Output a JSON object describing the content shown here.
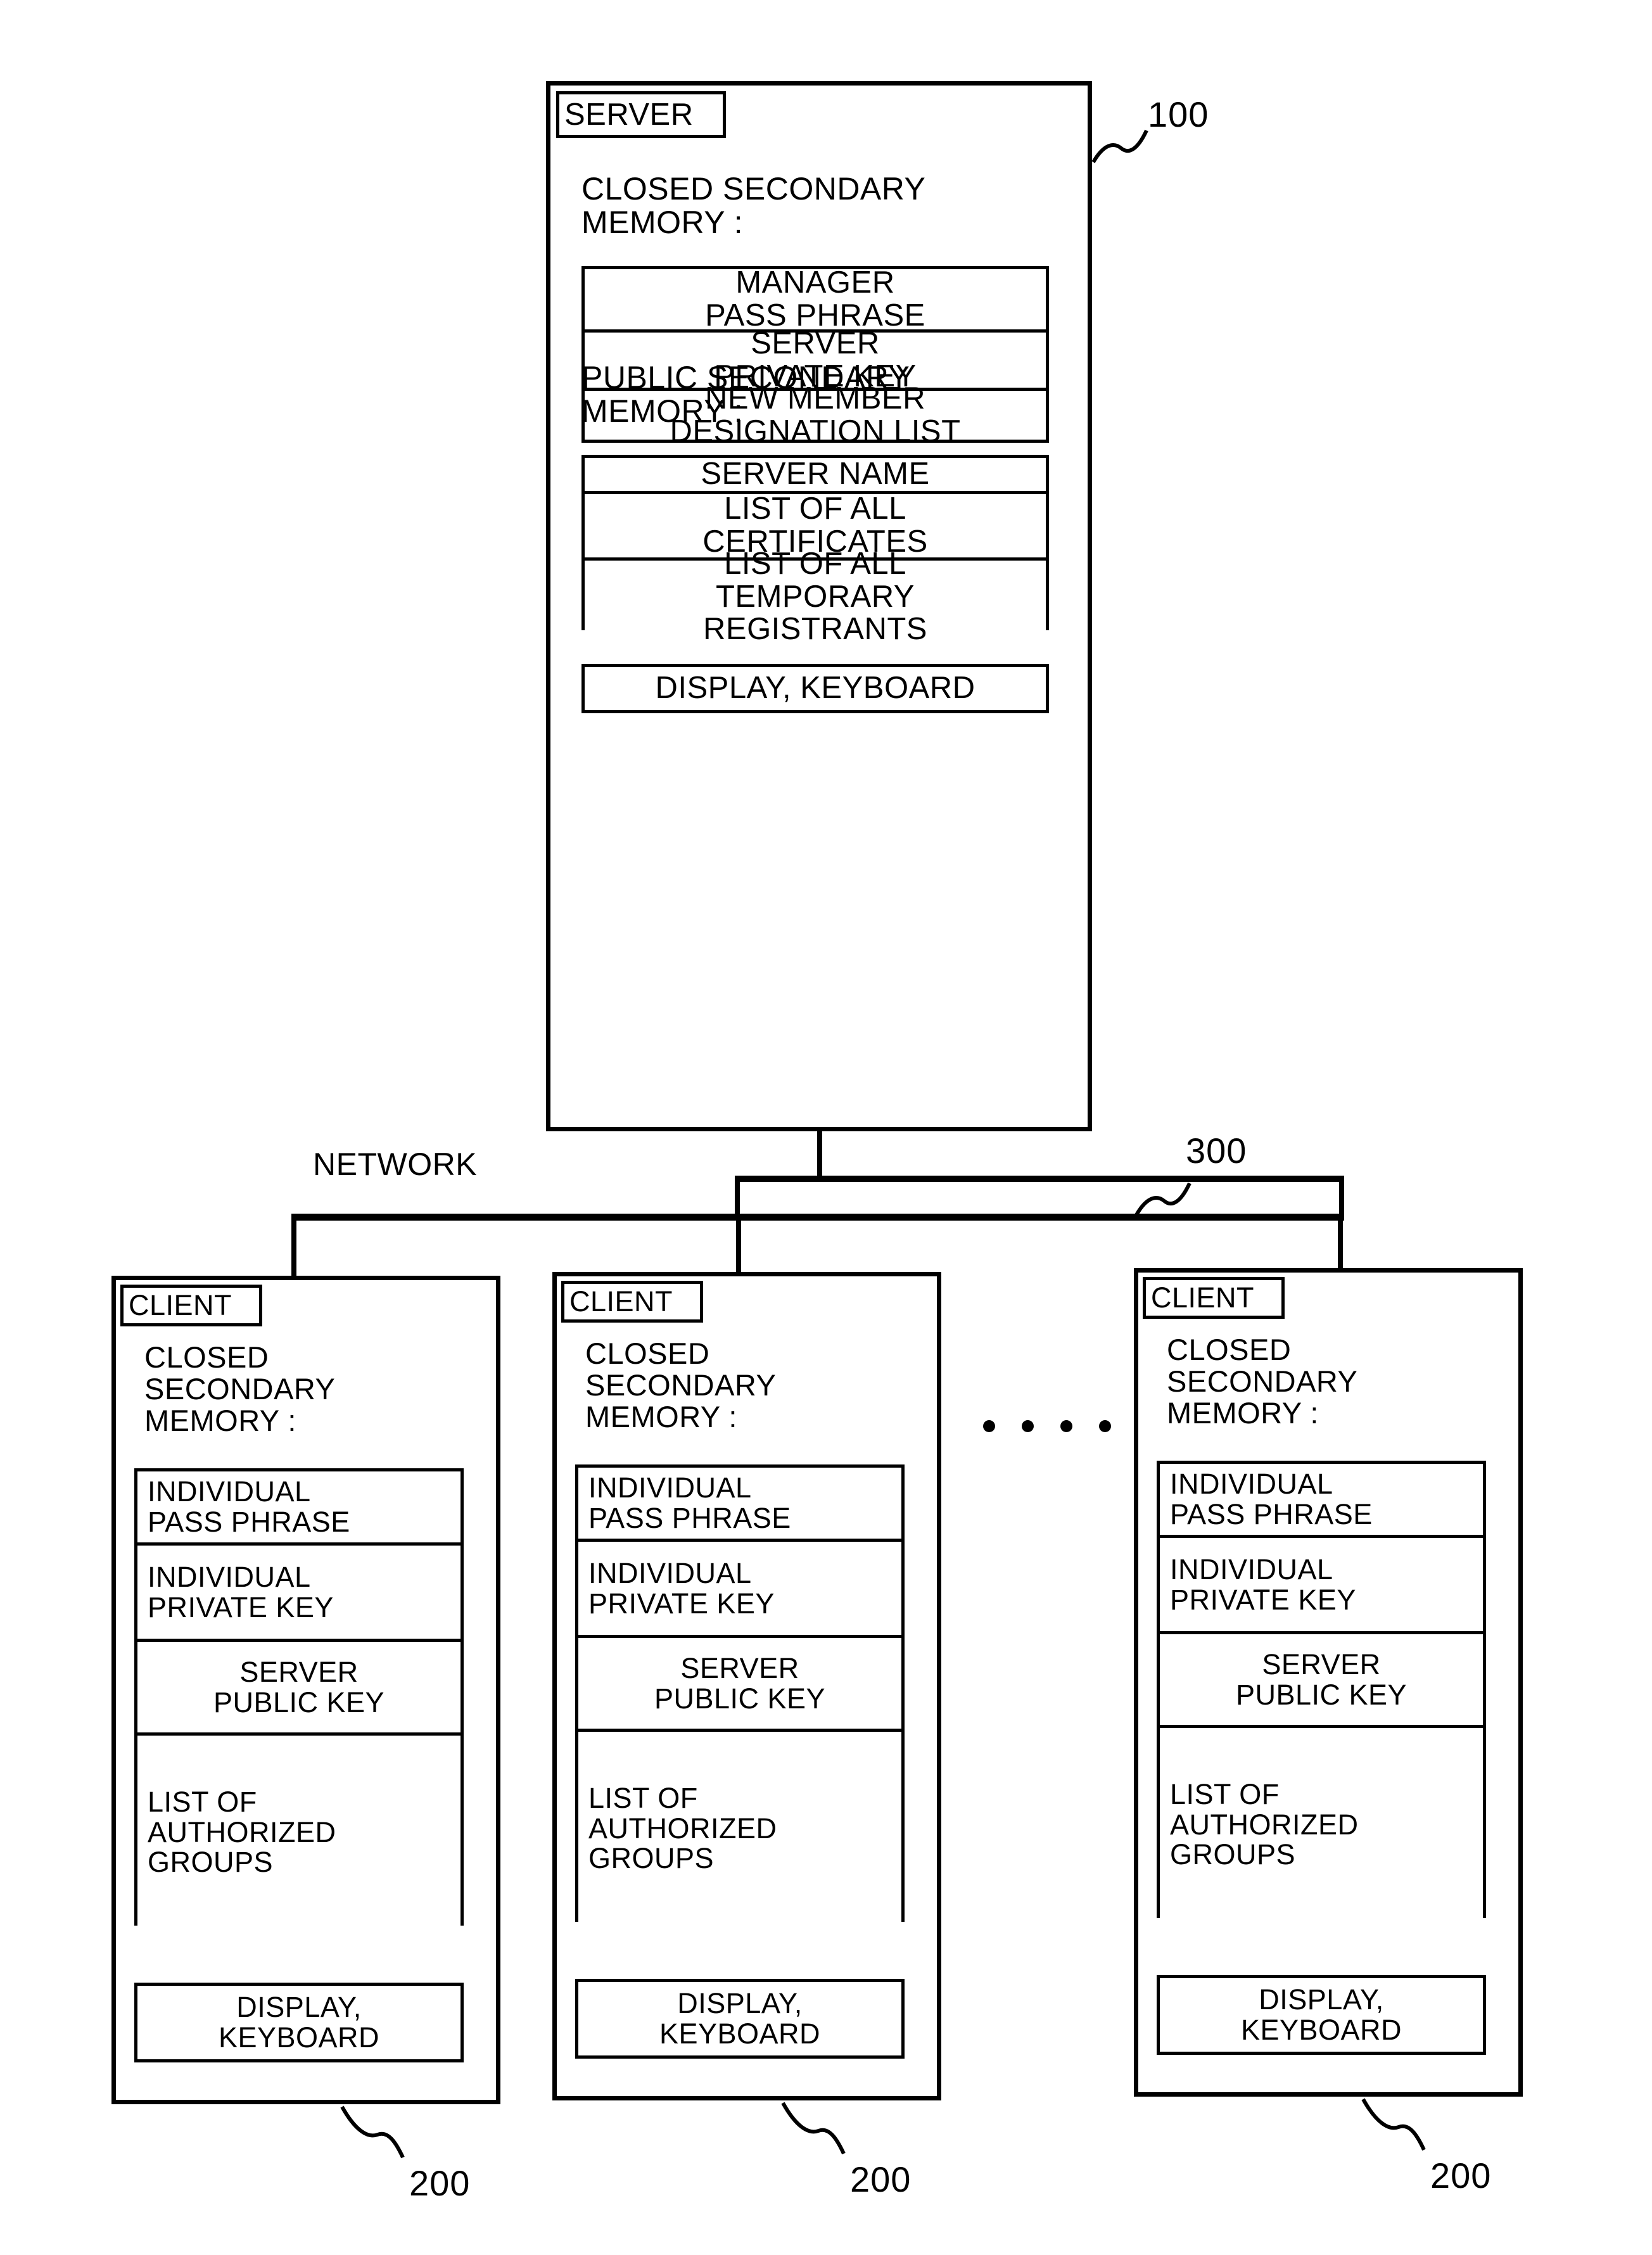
{
  "figure": {
    "network_label": "NETWORK",
    "ellipsis_dot_count": 4
  },
  "server": {
    "tag": "SERVER",
    "ref": "100",
    "closed_memory_heading": "CLOSED SECONDARY\nMEMORY :",
    "closed_memory_items": [
      {
        "line1": "MANAGER",
        "line2": "PASS PHRASE"
      },
      {
        "line1": "SERVER",
        "line2": "PRIVATE KEY"
      },
      {
        "line1": "NEW MEMBER",
        "line2": "DESIGNATION LIST"
      }
    ],
    "public_memory_heading": "PUBLIC SECONDARY\nMEMORY :",
    "public_memory_items": [
      {
        "line1": "SERVER NAME",
        "line2": "",
        "line3": ""
      },
      {
        "line1": "LIST OF ALL",
        "line2": "CERTIFICATES",
        "line3": ""
      },
      {
        "line1": "LIST OF ALL",
        "line2": "TEMPORARY",
        "line3": "REGISTRANTS"
      }
    ],
    "io_box": "DISPLAY, KEYBOARD"
  },
  "network": {
    "label": "NETWORK",
    "ref": "300"
  },
  "clients": [
    {
      "tag": "CLIENT",
      "ref": "200",
      "closed_memory_heading": "CLOSED\nSECONDARY\nMEMORY :",
      "memory_items": [
        {
          "line1": "INDIVIDUAL",
          "line2": "PASS PHRASE",
          "line3": "",
          "align": "left"
        },
        {
          "line1": "INDIVIDUAL",
          "line2": "PRIVATE KEY",
          "line3": "",
          "align": "left"
        },
        {
          "line1": "SERVER",
          "line2": "PUBLIC KEY",
          "line3": "",
          "align": "center"
        },
        {
          "line1": "LIST OF",
          "line2": "AUTHORIZED",
          "line3": "GROUPS",
          "align": "left"
        }
      ],
      "io_line1": "DISPLAY,",
      "io_line2": "KEYBOARD"
    },
    {
      "tag": "CLIENT",
      "ref": "200",
      "closed_memory_heading": "CLOSED\nSECONDARY\nMEMORY :",
      "memory_items": [
        {
          "line1": "INDIVIDUAL",
          "line2": "PASS PHRASE",
          "line3": "",
          "align": "left"
        },
        {
          "line1": "INDIVIDUAL",
          "line2": "PRIVATE KEY",
          "line3": "",
          "align": "left"
        },
        {
          "line1": "SERVER",
          "line2": "PUBLIC KEY",
          "line3": "",
          "align": "center"
        },
        {
          "line1": "LIST OF",
          "line2": "AUTHORIZED",
          "line3": "GROUPS",
          "align": "left"
        }
      ],
      "io_line1": "DISPLAY,",
      "io_line2": "KEYBOARD"
    },
    {
      "tag": "CLIENT",
      "ref": "200",
      "closed_memory_heading": "CLOSED\nSECONDARY\nMEMORY :",
      "memory_items": [
        {
          "line1": "INDIVIDUAL",
          "line2": "PASS PHRASE",
          "line3": "",
          "align": "left"
        },
        {
          "line1": "INDIVIDUAL",
          "line2": "PRIVATE KEY",
          "line3": "",
          "align": "left"
        },
        {
          "line1": "SERVER",
          "line2": "PUBLIC KEY",
          "line3": "",
          "align": "center"
        },
        {
          "line1": "LIST OF",
          "line2": "AUTHORIZED",
          "line3": "GROUPS",
          "align": "left"
        }
      ],
      "io_line1": "DISPLAY,",
      "io_line2": "KEYBOARD"
    }
  ],
  "colors": {
    "ink": "#000000",
    "paper": "#ffffff"
  }
}
